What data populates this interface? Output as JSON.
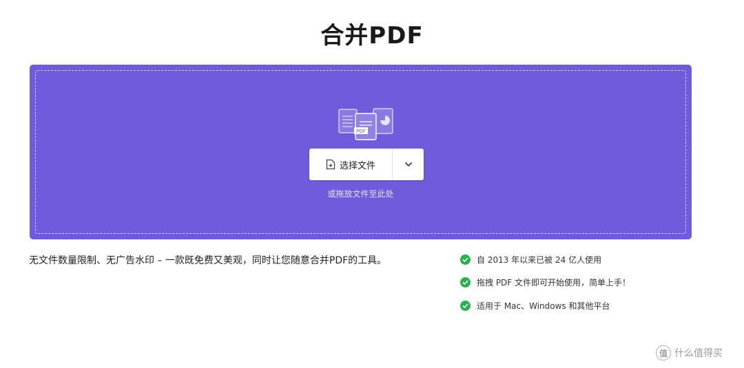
{
  "page": {
    "title": "合并PDF"
  },
  "upload": {
    "select_button_label": "选择文件",
    "dropdown_icon": "chevron-down-icon",
    "drop_hint": "或拖放文件至此处",
    "illustration_label": "PDF",
    "background_color": "#6f5bdc"
  },
  "description": {
    "text": "无文件数量限制、无广告水印 – 一款既免费又美观，同时让您随意合并PDF的工具。"
  },
  "features": [
    {
      "icon": "check-circle-icon",
      "text": "自 2013 年以来已被 24 亿人使用"
    },
    {
      "icon": "check-circle-icon",
      "text": "拖拽 PDF 文件即可开始使用，简单上手！"
    },
    {
      "icon": "check-circle-icon",
      "text": "适用于 Mac、Windows 和其他平台"
    }
  ],
  "watermark": {
    "logo_text": "值",
    "text": "什么值得买"
  },
  "colors": {
    "accent": "#6f5bdc",
    "check": "#28b24b"
  }
}
